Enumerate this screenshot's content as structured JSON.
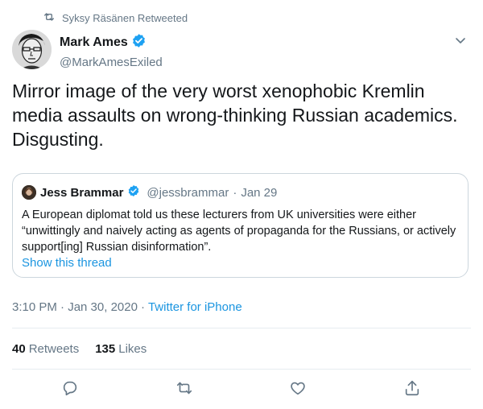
{
  "retweet_banner": {
    "text": "Syksy Räsänen Retweeted",
    "icon": "retweet-icon"
  },
  "author": {
    "name": "Mark Ames",
    "handle": "@MarkAmesExiled",
    "verified": true
  },
  "tweet": {
    "text": "Mirror image of the very worst xenophobic Kremlin media assaults on wrong-thinking Russian academics. Disgusting."
  },
  "quoted_tweet": {
    "name": "Jess Brammar",
    "handle": "@jessbrammar",
    "separator": "·",
    "date": "Jan 29",
    "text": "A European diplomat told us these lecturers from UK universities were either “unwittingly and naively acting as agents of propaganda for the Russians, or actively support[ing] Russian disinformation”.",
    "show_thread": "Show this thread"
  },
  "meta": {
    "timestamp": "3:10 PM · Jan 30, 2020",
    "separator": "·",
    "source": "Twitter for iPhone"
  },
  "stats": {
    "retweets_count": "40",
    "retweets_label": "Retweets",
    "likes_count": "135",
    "likes_label": "Likes"
  },
  "colors": {
    "accent": "#1da1f2",
    "link": "#1b95e0",
    "muted": "#657786",
    "border": "#e6ecf0"
  }
}
